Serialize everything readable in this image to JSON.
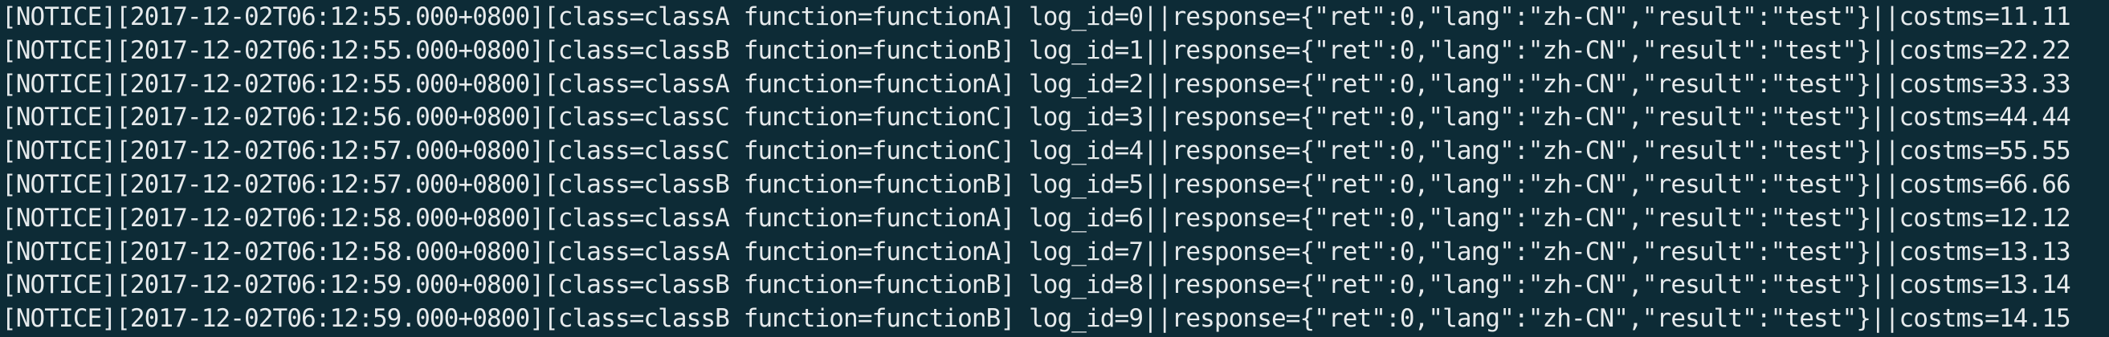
{
  "terminal": {
    "lines": [
      "[NOTICE][2017-12-02T06:12:55.000+0800][class=classA function=functionA] log_id=0||response={\"ret\":0,\"lang\":\"zh-CN\",\"result\":\"test\"}||costms=11.11",
      "[NOTICE][2017-12-02T06:12:55.000+0800][class=classB function=functionB] log_id=1||response={\"ret\":0,\"lang\":\"zh-CN\",\"result\":\"test\"}||costms=22.22",
      "[NOTICE][2017-12-02T06:12:55.000+0800][class=classA function=functionA] log_id=2||response={\"ret\":0,\"lang\":\"zh-CN\",\"result\":\"test\"}||costms=33.33",
      "[NOTICE][2017-12-02T06:12:56.000+0800][class=classC function=functionC] log_id=3||response={\"ret\":0,\"lang\":\"zh-CN\",\"result\":\"test\"}||costms=44.44",
      "[NOTICE][2017-12-02T06:12:57.000+0800][class=classC function=functionC] log_id=4||response={\"ret\":0,\"lang\":\"zh-CN\",\"result\":\"test\"}||costms=55.55",
      "[NOTICE][2017-12-02T06:12:57.000+0800][class=classB function=functionB] log_id=5||response={\"ret\":0,\"lang\":\"zh-CN\",\"result\":\"test\"}||costms=66.66",
      "[NOTICE][2017-12-02T06:12:58.000+0800][class=classA function=functionA] log_id=6||response={\"ret\":0,\"lang\":\"zh-CN\",\"result\":\"test\"}||costms=12.12",
      "[NOTICE][2017-12-02T06:12:58.000+0800][class=classA function=functionA] log_id=7||response={\"ret\":0,\"lang\":\"zh-CN\",\"result\":\"test\"}||costms=13.13",
      "[NOTICE][2017-12-02T06:12:59.000+0800][class=classB function=functionB] log_id=8||response={\"ret\":0,\"lang\":\"zh-CN\",\"result\":\"test\"}||costms=13.14",
      "[NOTICE][2017-12-02T06:12:59.000+0800][class=classB function=functionB] log_id=9||response={\"ret\":0,\"lang\":\"zh-CN\",\"result\":\"test\"}||costms=14.15"
    ]
  },
  "colors": {
    "background": "#0d2b36",
    "text": "#e6eaec"
  }
}
